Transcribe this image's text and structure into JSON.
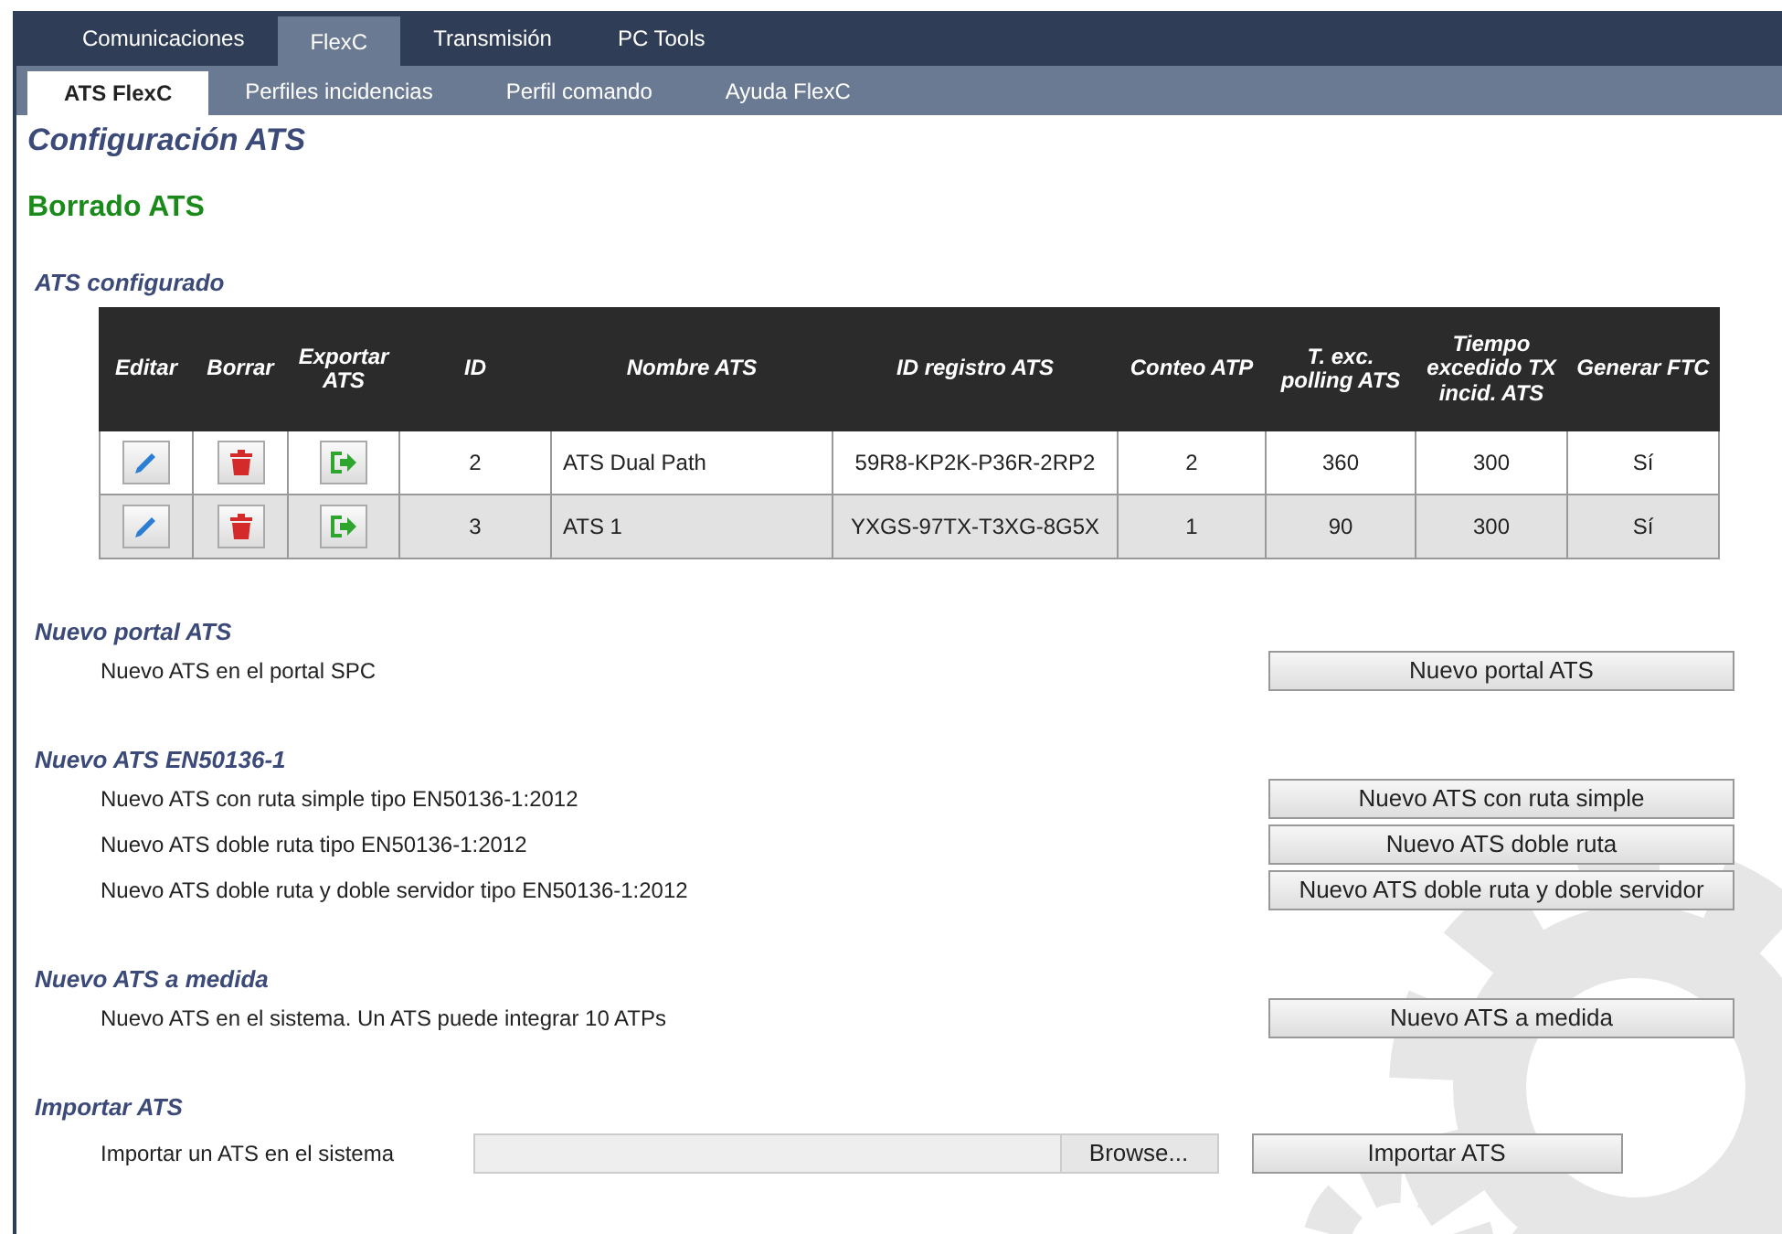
{
  "tabs": [
    {
      "label": "Comunicaciones",
      "selected": false
    },
    {
      "label": "FlexC",
      "selected": true
    },
    {
      "label": "Transmisión",
      "selected": false
    },
    {
      "label": "PC Tools",
      "selected": false
    }
  ],
  "subtabs": [
    {
      "label": "ATS FlexC",
      "selected": true
    },
    {
      "label": "Perfiles incidencias",
      "selected": false
    },
    {
      "label": "Perfil comando",
      "selected": false
    },
    {
      "label": "Ayuda FlexC",
      "selected": false
    }
  ],
  "page_title": "Configuración ATS",
  "delete_link": "Borrado ATS",
  "table": {
    "title": "ATS configurado",
    "columns": [
      "Editar",
      "Borrar",
      "Exportar ATS",
      "ID",
      "Nombre ATS",
      "ID registro ATS",
      "Conteo ATP",
      "T. exc. polling ATS",
      "Tiempo excedido TX incid. ATS",
      "Generar FTC"
    ],
    "rows": [
      {
        "id": "2",
        "name": "ATS Dual Path",
        "registry_id": "59R8-KP2K-P36R-2RP2",
        "atp_count": "2",
        "polling_timeout": "360",
        "tx_timeout": "300",
        "ftc": "Sí"
      },
      {
        "id": "3",
        "name": "ATS 1",
        "registry_id": "YXGS-97TX-T3XG-8G5X",
        "atp_count": "1",
        "polling_timeout": "90",
        "tx_timeout": "300",
        "ftc": "Sí"
      }
    ]
  },
  "sections": [
    {
      "title": "Nuevo portal ATS",
      "items": [
        {
          "kind": "button",
          "text": "Nuevo ATS en el portal SPC",
          "button": "Nuevo portal ATS"
        }
      ]
    },
    {
      "title": "Nuevo ATS EN50136-1",
      "items": [
        {
          "kind": "button",
          "text": "Nuevo ATS con ruta simple tipo EN50136-1:2012",
          "button": "Nuevo ATS con ruta simple"
        },
        {
          "kind": "button",
          "text": "Nuevo ATS doble ruta tipo EN50136-1:2012",
          "button": "Nuevo ATS doble ruta"
        },
        {
          "kind": "button",
          "text": "Nuevo ATS doble ruta y doble servidor tipo EN50136-1:2012",
          "button": "Nuevo ATS doble ruta y doble servidor"
        }
      ]
    },
    {
      "title": "Nuevo ATS a medida",
      "items": [
        {
          "kind": "button",
          "text": "Nuevo ATS en el sistema. Un ATS puede integrar 10 ATPs",
          "button": "Nuevo ATS a medida"
        }
      ]
    },
    {
      "title": "Importar ATS",
      "items": [
        {
          "kind": "file",
          "text": "Importar un ATS en el sistema",
          "browse": "Browse...",
          "button": "Importar ATS"
        }
      ]
    }
  ]
}
